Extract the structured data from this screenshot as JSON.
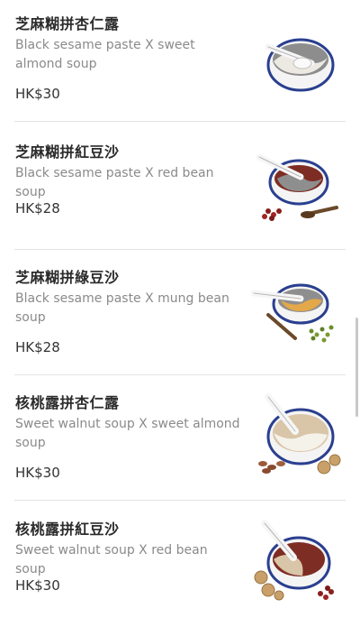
{
  "menu": {
    "items": [
      {
        "title": "芝麻糊拼杏仁露",
        "description": "Black sesame paste X sweet almond soup",
        "price": "HK$30",
        "image_icon": "sesame-almond-soup-icon"
      },
      {
        "title": "芝麻糊拼紅豆沙",
        "description": "Black sesame paste X red bean soup",
        "price": "HK$28",
        "image_icon": "sesame-red-bean-soup-icon"
      },
      {
        "title": "芝麻糊拼綠豆沙",
        "description": "Black sesame paste X mung bean soup",
        "price": "HK$28",
        "image_icon": "sesame-mung-bean-soup-icon"
      },
      {
        "title": "核桃露拼杏仁露",
        "description": "Sweet walnut soup X sweet almond soup",
        "price": "HK$30",
        "image_icon": "walnut-almond-soup-icon"
      },
      {
        "title": "核桃露拼紅豆沙",
        "description": "Sweet walnut soup X red bean soup",
        "price": "HK$30",
        "image_icon": "walnut-red-bean-soup-icon"
      }
    ]
  },
  "colors": {
    "title": "#2b2b2b",
    "description": "#8a8a8a",
    "price": "#333333",
    "divider": "#e3e3e3",
    "bowl_rim": "#2a3f8f"
  }
}
